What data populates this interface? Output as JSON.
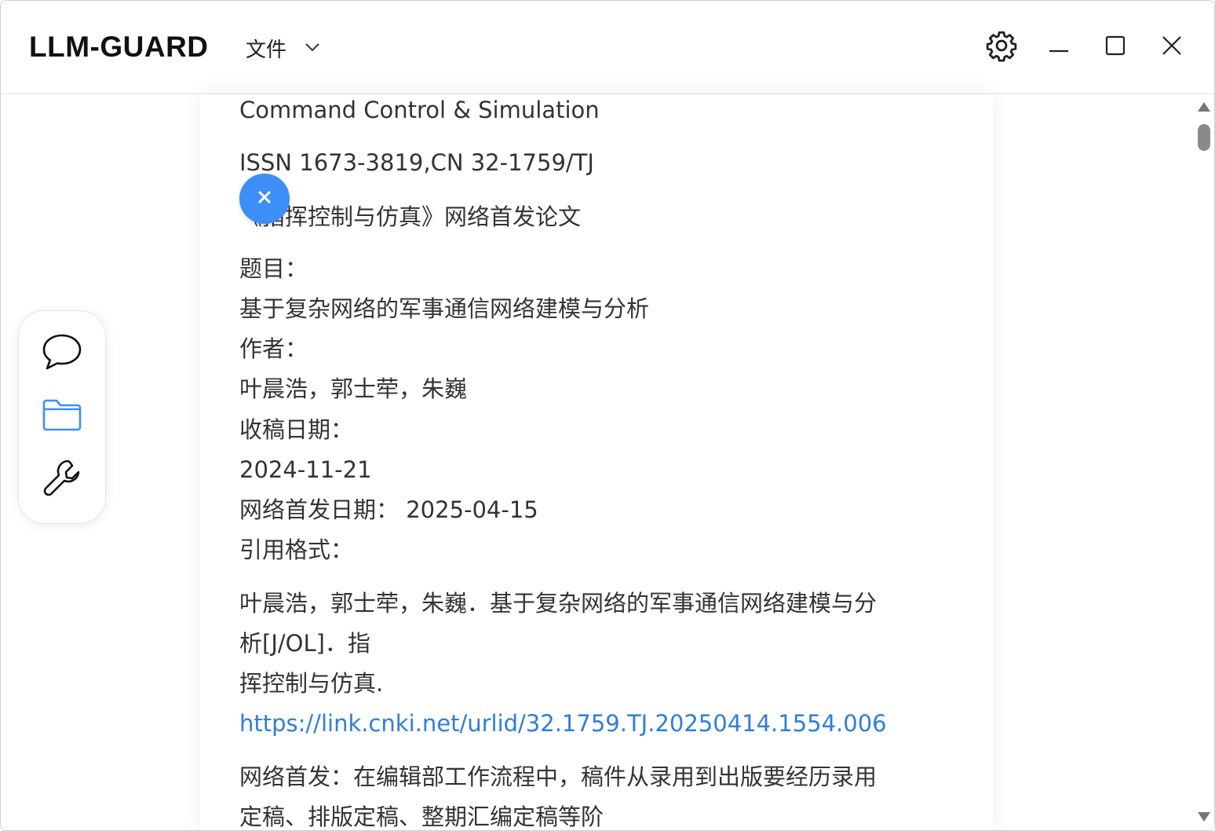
{
  "app": {
    "title": "LLM-GUARD"
  },
  "menu": {
    "file_label": "文件"
  },
  "icons": {
    "settings": "gear-icon",
    "minimize": "minimize-icon",
    "maximize": "maximize-icon",
    "close": "close-icon",
    "dropdown": "chevron-down-icon",
    "float_close": "close-icon",
    "chat": "chat-bubble-icon",
    "folder": "folder-icon",
    "tools": "wrench-icon"
  },
  "colors": {
    "accent": "#3d8ef7",
    "link": "#2f7ed8",
    "text": "#333333"
  },
  "document": {
    "lines": [
      "Command Control & Simulation",
      "ISSN 1673-3819,CN 32-1759/TJ",
      "《指挥控制与仿真》网络首发论文",
      "题目：",
      "基于复杂网络的军事通信网络建模与分析",
      "作者：",
      "叶晨浩，郭士荦，朱巍",
      "收稿日期：",
      "2024-11-21",
      "网络首发日期：  2025-04-15",
      "引用格式：",
      "叶晨浩，郭士荦，朱巍．基于复杂网络的军事通信网络建模与分",
      "析[J/OL]．指",
      "挥控制与仿真.",
      "https://link.cnki.net/urlid/32.1759.TJ.20250414.1554.006",
      "网络首发：在编辑部工作流程中，稿件从录用到出版要经历录用",
      "定稿、排版定稿、整期汇编定稿等阶"
    ]
  }
}
